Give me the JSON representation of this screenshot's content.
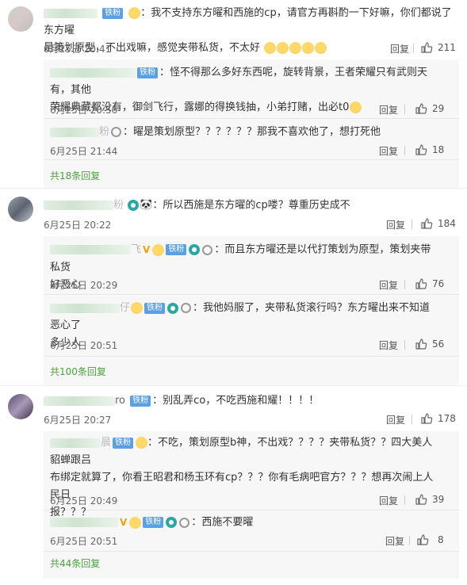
{
  "ui": {
    "reply_label": "回复"
  },
  "comments": [
    {
      "name_suffix": "",
      "badge": "铁粉",
      "text_l1": "我不支持东方曜和西施的cp，请官方再斟酌一下好嘛，你们都说了东方曜",
      "text_l2": "是策划原型，不出戏嘛，感觉夹带私货，不太好",
      "time": "6月25日 20:41",
      "likes": "211",
      "subs": [
        {
          "badge": "铁粉",
          "text_l1": "怪不得那么多好东西呢，旋转背景，王者荣耀只有武则天有，其他",
          "text_l2": "荣耀典藏都没有，御剑飞行，露娜的得换钱抽，小弟打赌，出必t0",
          "time": "6月25日 20:56",
          "likes": "29"
        },
        {
          "name_suffix": "粉",
          "text_l1": "曜是策划原型？？？？？？那我不喜欢他了，想打死他",
          "time": "6月25日 21:44",
          "likes": "18"
        }
      ],
      "more": "共18条回复"
    },
    {
      "name_suffix": "粉",
      "text_l1": "所以西施是东方曜的cp喽？尊重历史成不",
      "time": "6月25日 20:22",
      "likes": "184",
      "subs": [
        {
          "name_suffix": "飞",
          "badge": "铁粉",
          "text_l1": "而且东方曜还是以代打策划为原型，策划夹带私货",
          "text_l2": "好恶心",
          "time": "6月25日 20:29",
          "likes": "76"
        },
        {
          "name_suffix": "仔",
          "badge": "铁粉",
          "text_l1": "我他妈服了，夹带私货滚行吗？东方曜出来不知道恶心了",
          "text_l2": "多少人",
          "time": "6月25日 20:51",
          "likes": "56"
        }
      ],
      "more": "共100条回复"
    },
    {
      "name_suffix": "ro",
      "badge": "铁粉",
      "text_l1": "别乱弄co，不吃西施和耀！！！！",
      "time": "6月25日 20:27",
      "likes": "178",
      "subs": [
        {
          "name_suffix": "晨",
          "badge": "铁粉",
          "text_l1": "不吃，策划原型b神，不出戏？？？？夹带私货？？四大美人貂蝉跟吕",
          "text_l2": "布绑定就算了，你看王昭君和杨玉环有cp？？？你有毛病吧官方？？？想再次闹上人民日",
          "text_l3": "报？？？",
          "time": "6月25日 20:49",
          "likes": "39"
        },
        {
          "badge": "铁粉",
          "text_l1": "西施不要曜",
          "time": "6月25日 20:51",
          "likes": "8"
        }
      ],
      "more": "共44条回复"
    }
  ],
  "colors": {
    "accent_green": "#4c9f3f",
    "badge_blue": "#5b9fe4",
    "sub_bg": "#f7f7f7"
  },
  "icons": [
    "thumb-up-icon",
    "emoji-icon",
    "fan-ring-icon",
    "vip-v-icon",
    "panda-icon"
  ]
}
